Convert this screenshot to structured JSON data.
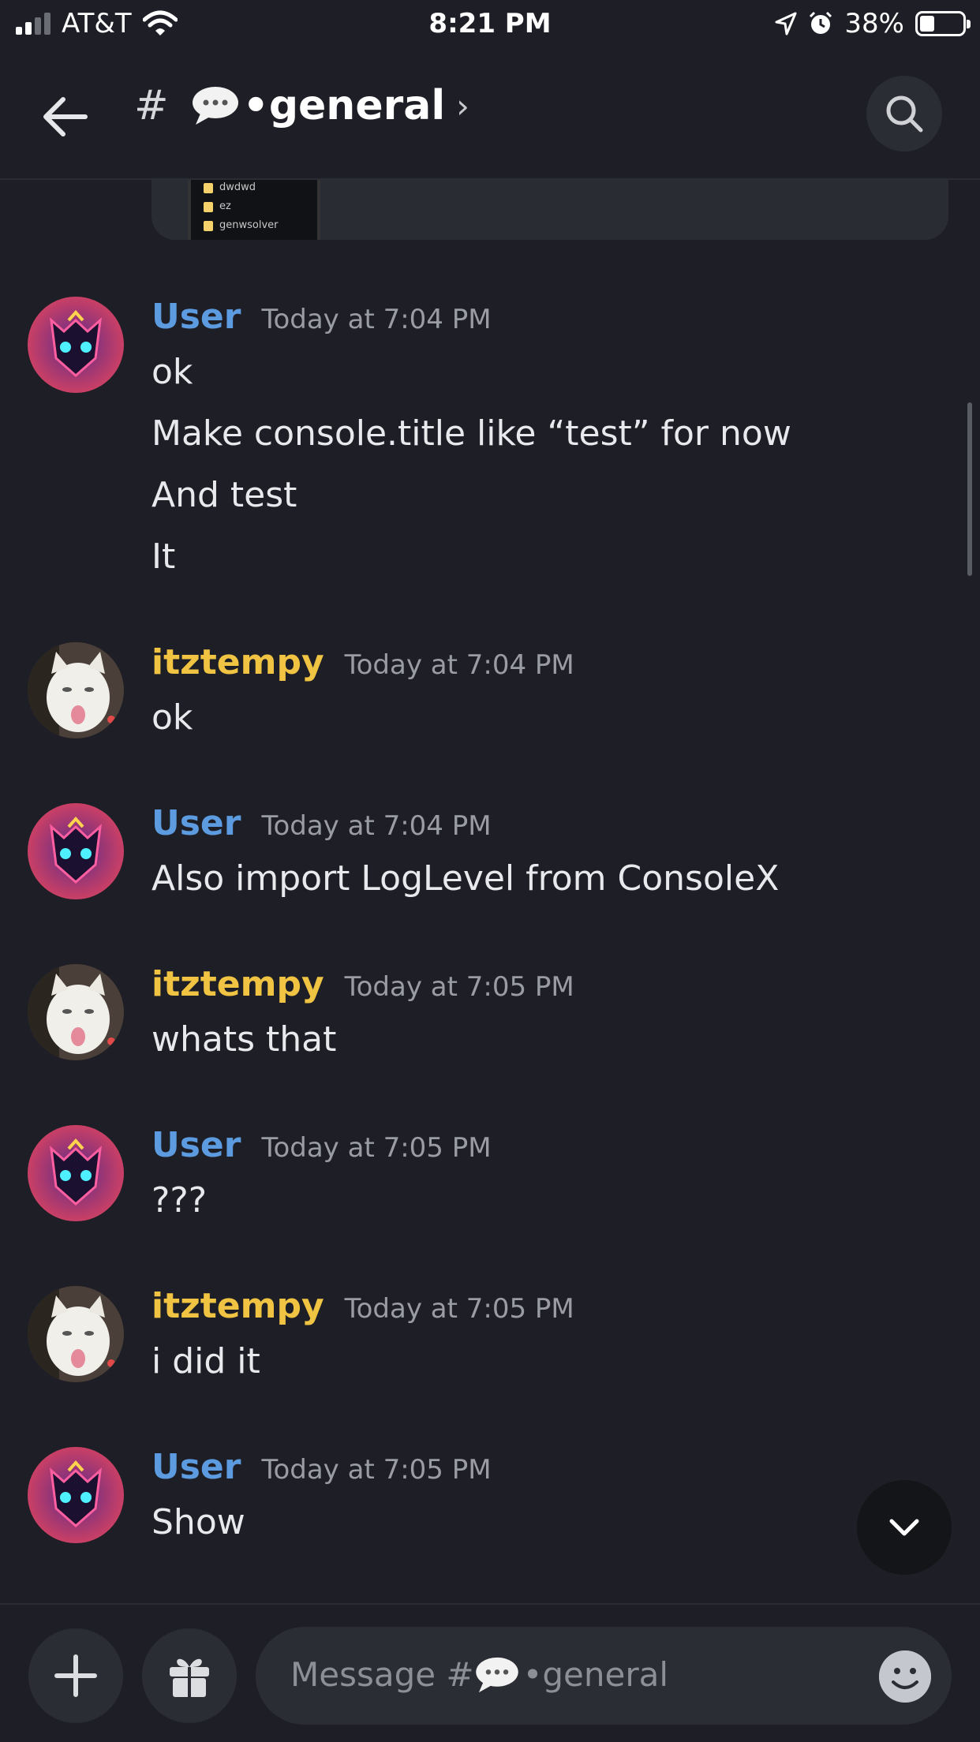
{
  "status_bar": {
    "carrier": "AT&T",
    "time": "8:21 PM",
    "battery_percent": "38%",
    "battery_level": 0.38
  },
  "header": {
    "hash": "#",
    "channel_name": "•general",
    "chevron": "›"
  },
  "messages": [
    {
      "author": "User",
      "time": "Today at 7:04 PM",
      "lines": [
        "ok",
        "Make console.title like “test” for now",
        "And test",
        "It"
      ]
    },
    {
      "author": "itztempy",
      "time": "Today at 7:04 PM",
      "lines": [
        "ok"
      ]
    },
    {
      "author": "User",
      "time": "Today at 7:04 PM",
      "lines": [
        "Also import LogLevel from ConsoleX"
      ]
    },
    {
      "author": "itztempy",
      "time": "Today at 7:05 PM",
      "lines": [
        "whats that"
      ]
    },
    {
      "author": "User",
      "time": "Today at 7:05 PM",
      "lines": [
        "???"
      ]
    },
    {
      "author": "itztempy",
      "time": "Today at 7:05 PM",
      "lines": [
        "i did it"
      ]
    },
    {
      "author": "User",
      "time": "Today at 7:05 PM",
      "lines": [
        "Show"
      ]
    }
  ],
  "embed_preview": {
    "folders": [
      "dwdwd",
      "ez",
      "genwsolver"
    ]
  },
  "composer": {
    "placeholder_prefix": "Message #",
    "placeholder_channel": "•general"
  },
  "colors": {
    "background": "#1e1f26",
    "user_name": "#5d9be0",
    "itztempy_name": "#f0c442"
  },
  "icons": [
    "back-arrow-icon",
    "search-icon",
    "plus-icon",
    "gift-icon",
    "emoji-icon",
    "chevron-down-icon",
    "speech-bubble-icon"
  ]
}
